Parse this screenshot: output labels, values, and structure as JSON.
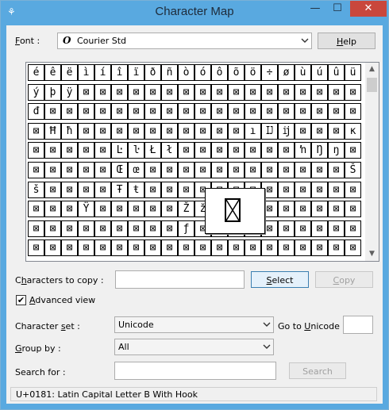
{
  "window": {
    "title": "Character Map",
    "minimize": "—",
    "maximize": "☐",
    "close": "✕"
  },
  "font": {
    "label": "Font :",
    "value": "Courier Std",
    "icon": "O"
  },
  "help_label": "Help",
  "grid": {
    "rows": [
      [
        "é",
        "ê",
        "ë",
        "ì",
        "í",
        "î",
        "ï",
        "ð",
        "ñ",
        "ò",
        "ó",
        "ô",
        "õ",
        "ö",
        "÷",
        "ø",
        "ù",
        "ú",
        "û",
        "ü"
      ],
      [
        "ý",
        "þ",
        "ÿ",
        "⊠",
        "⊠",
        "⊠",
        "⊠",
        "⊠",
        "⊠",
        "⊠",
        "⊠",
        "⊠",
        "⊠",
        "⊠",
        "⊠",
        "⊠",
        "⊠",
        "⊠",
        "⊠",
        "⊠"
      ],
      [
        "đ",
        "⊠",
        "⊠",
        "⊠",
        "⊠",
        "⊠",
        "⊠",
        "⊠",
        "⊠",
        "⊠",
        "⊠",
        "⊠",
        "⊠",
        "⊠",
        "⊠",
        "⊠",
        "⊠",
        "⊠",
        "⊠",
        "⊠"
      ],
      [
        "⊠",
        "Ħ",
        "ħ",
        "⊠",
        "⊠",
        "⊠",
        "⊠",
        "⊠",
        "⊠",
        "⊠",
        "⊠",
        "⊠",
        "⊠",
        "ı",
        "Ĳ",
        "ĳ",
        "⊠",
        "⊠",
        "⊠",
        "ĸ"
      ],
      [
        "⊠",
        "⊠",
        "⊠",
        "⊠",
        "⊠",
        "Ŀ",
        "ŀ",
        "Ł",
        "ł",
        "⊠",
        "⊠",
        "⊠",
        "⊠",
        "⊠",
        "⊠",
        "⊠",
        "ŉ",
        "Ŋ",
        "ŋ",
        "⊠"
      ],
      [
        "⊠",
        "⊠",
        "⊠",
        "⊠",
        "⊠",
        "Œ",
        "œ",
        "⊠",
        "⊠",
        "⊠",
        "⊠",
        "⊠",
        "⊠",
        "⊠",
        "⊠",
        "⊠",
        "⊠",
        "⊠",
        "⊠",
        "Š"
      ],
      [
        "š",
        "⊠",
        "⊠",
        "⊠",
        "⊠",
        "Ŧ",
        "ŧ",
        "⊠",
        "⊠",
        "⊠",
        "⊠",
        "⊠",
        "⊠",
        "⊠",
        "⊠",
        "⊠",
        "⊠",
        "⊠",
        "⊠",
        "⊠"
      ],
      [
        "⊠",
        "⊠",
        "⊠",
        "Ÿ",
        "⊠",
        "⊠",
        "⊠",
        "⊠",
        "⊠",
        "Ž",
        "ž",
        "⊠",
        "⊠",
        "⊠",
        "⊠",
        "⊠",
        "⊠",
        "⊠",
        "⊠",
        "⊠"
      ],
      [
        "⊠",
        "⊠",
        "⊠",
        "⊠",
        "⊠",
        "⊠",
        "⊠",
        "⊠",
        "⊠",
        "ƒ",
        "⊠",
        "⊠",
        "⊠",
        "⊠",
        "⊠",
        "⊠",
        "⊠",
        "⊠",
        "⊠",
        "⊠"
      ],
      [
        "⊠",
        "⊠",
        "⊠",
        "⊠",
        "⊠",
        "⊠",
        "⊠",
        "⊠",
        "⊠",
        "⊠",
        "⊠",
        "⊠",
        "⊠",
        "⊠",
        "⊠",
        "⊠",
        "⊠",
        "⊠",
        "⊠",
        "⊠"
      ]
    ],
    "zoomed_glyph": "⊠"
  },
  "copy": {
    "label": "Characters to copy :",
    "value": "",
    "select_label": "Select",
    "copy_label": "Copy"
  },
  "advanced": {
    "label": "Advanced view",
    "checked": true,
    "check_glyph": "✔"
  },
  "charset": {
    "label": "Character set :",
    "value": "Unicode",
    "goto_label": "Go to Unicode :",
    "goto_value": ""
  },
  "groupby": {
    "label": "Group by :",
    "value": "All"
  },
  "search": {
    "label": "Search for :",
    "value": "",
    "button_label": "Search"
  },
  "status_text": "U+0181: Latin Capital Letter B With Hook"
}
